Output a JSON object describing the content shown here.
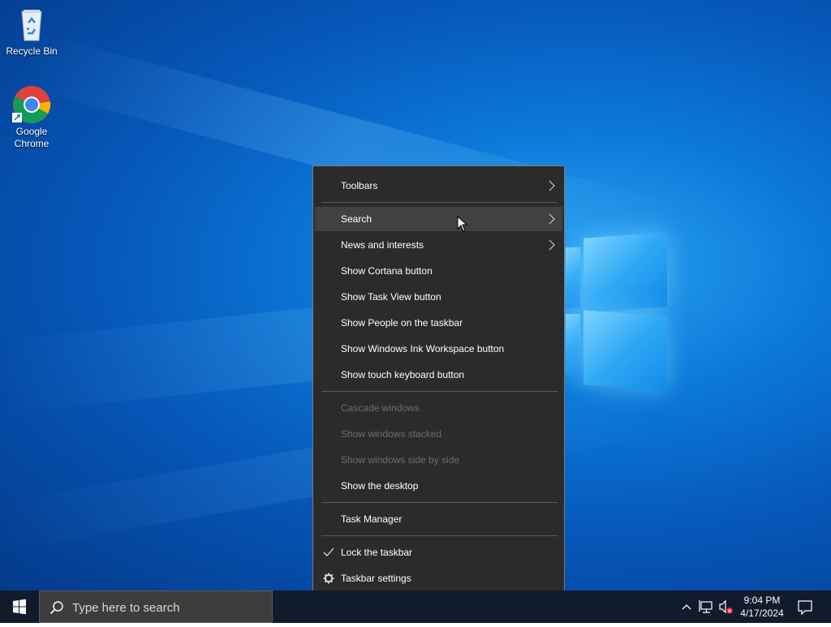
{
  "desktop": {
    "icons": [
      {
        "label": "Recycle Bin",
        "icon": "recycle-bin-icon"
      },
      {
        "label": "Google\nChrome",
        "icon": "chrome-icon"
      }
    ]
  },
  "context_menu": {
    "items": [
      {
        "label": "Toolbars",
        "submenu": true,
        "enabled": true
      },
      {
        "label": "Search",
        "submenu": true,
        "enabled": true,
        "hovered": true
      },
      {
        "label": "News and interests",
        "submenu": true,
        "enabled": true
      },
      {
        "label": "Show Cortana button",
        "enabled": true
      },
      {
        "label": "Show Task View button",
        "enabled": true
      },
      {
        "label": "Show People on the taskbar",
        "enabled": true
      },
      {
        "label": "Show Windows Ink Workspace button",
        "enabled": true
      },
      {
        "label": "Show touch keyboard button",
        "enabled": true
      },
      {
        "label": "Cascade windows",
        "enabled": false
      },
      {
        "label": "Show windows stacked",
        "enabled": false
      },
      {
        "label": "Show windows side by side",
        "enabled": false
      },
      {
        "label": "Show the desktop",
        "enabled": true
      },
      {
        "label": "Task Manager",
        "enabled": true
      },
      {
        "label": "Lock the taskbar",
        "enabled": true,
        "checked": true
      },
      {
        "label": "Taskbar settings",
        "enabled": true,
        "icon": "gear-icon"
      }
    ]
  },
  "taskbar": {
    "search_placeholder": "Type here to search",
    "clock_time": "9:04 PM",
    "clock_date": "4/17/2024",
    "tray_icons": [
      "chevron-up-icon",
      "network-icon",
      "volume-muted-icon",
      "notification-icon"
    ]
  },
  "colors": {
    "menu_bg": "#2b2b2b",
    "menu_hover": "#414141",
    "taskbar_bg": "#101b2b",
    "disabled_text": "#6d6d6d"
  }
}
